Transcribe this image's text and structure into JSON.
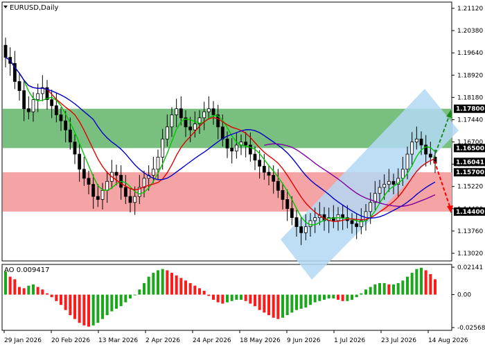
{
  "window": {
    "title": "EURUSD,Daily",
    "menu_icon": "triangle-down-icon"
  },
  "colors": {
    "support_zone": "#f4a4a4",
    "resistance_zone": "#78bf80",
    "channel": "#b3d8f3",
    "candle": "#000000",
    "fast_ma": "#00c800",
    "mid_ma": "#e00000",
    "slow_ma": "#0000c8",
    "purple_ma": "#8000a0",
    "ao_up": "#1aa81a",
    "ao_down": "#ff1a1a",
    "arrow_up": "#1e8a1e",
    "arrow_down": "#ff0000"
  },
  "price_axis": {
    "ticks": [
      "1.21120",
      "1.20380",
      "1.19640",
      "1.18920",
      "1.18180",
      "1.17440",
      "1.16700",
      "1.15960",
      "1.15220",
      "1.14480",
      "1.13760",
      "1.13020"
    ]
  },
  "levels": [
    {
      "label": "1.17800",
      "value": 1.178
    },
    {
      "label": "1.16500",
      "value": 1.165
    },
    {
      "label": "1.16041",
      "value": 1.16041
    },
    {
      "label": "1.15700",
      "value": 1.157
    },
    {
      "label": "1.14400",
      "value": 1.144
    }
  ],
  "ao": {
    "label": "AO 0.009417",
    "ticks": [
      "0.02141",
      "0.00",
      "-0.025685"
    ]
  },
  "time_axis": {
    "labels": [
      "29 Jan 2026",
      "20 Feb 2026",
      "13 Mar 2026",
      "2 Apr 2026",
      "24 Apr 2026",
      "18 May 2026",
      "9 Jun 2026",
      "1 Jul 2026",
      "23 Jul 2026",
      "14 Aug 2026"
    ]
  },
  "chart_data": {
    "type": "candlestick",
    "symbol": "EURUSD",
    "timeframe": "Daily",
    "ylim": [
      1.1302,
      1.2112
    ],
    "zones": [
      {
        "type": "resistance",
        "from": 1.165,
        "to": 1.178
      },
      {
        "type": "support",
        "from": 1.144,
        "to": 1.157
      }
    ],
    "closes": [
      1.195,
      1.193,
      1.187,
      1.184,
      1.178,
      1.177,
      1.181,
      1.183,
      1.185,
      1.181,
      1.179,
      1.176,
      1.174,
      1.171,
      1.167,
      1.163,
      1.158,
      1.155,
      1.153,
      1.149,
      1.148,
      1.151,
      1.154,
      1.157,
      1.156,
      1.152,
      1.149,
      1.147,
      1.149,
      1.152,
      1.155,
      1.156,
      1.158,
      1.162,
      1.168,
      1.172,
      1.176,
      1.178,
      1.175,
      1.172,
      1.171,
      1.173,
      1.175,
      1.177,
      1.178,
      1.176,
      1.172,
      1.168,
      1.165,
      1.164,
      1.166,
      1.167,
      1.166,
      1.163,
      1.161,
      1.159,
      1.157,
      1.156,
      1.154,
      1.151,
      1.148,
      1.145,
      1.142,
      1.139,
      1.137,
      1.139,
      1.141,
      1.142,
      1.143,
      1.141,
      1.142,
      1.141,
      1.143,
      1.142,
      1.141,
      1.14,
      1.139,
      1.141,
      1.144,
      1.147,
      1.15,
      1.152,
      1.153,
      1.154,
      1.153,
      1.155,
      1.158,
      1.163,
      1.167,
      1.168,
      1.166,
      1.163,
      1.162,
      1.16
    ],
    "ao_values": [
      0.018,
      0.014,
      0.012,
      0.006,
      0.005,
      0.007,
      0.008,
      0.006,
      0.004,
      0.001,
      -0.002,
      -0.005,
      -0.008,
      -0.012,
      -0.016,
      -0.019,
      -0.022,
      -0.024,
      -0.025,
      -0.024,
      -0.022,
      -0.019,
      -0.016,
      -0.013,
      -0.011,
      -0.009,
      -0.006,
      -0.003,
      0.0,
      0.004,
      0.009,
      0.014,
      0.017,
      0.019,
      0.02,
      0.019,
      0.017,
      0.015,
      0.013,
      0.011,
      0.009,
      0.007,
      0.005,
      0.003,
      -0.001,
      -0.004,
      -0.006,
      -0.007,
      -0.006,
      -0.005,
      -0.004,
      -0.004,
      -0.005,
      -0.007,
      -0.009,
      -0.012,
      -0.014,
      -0.016,
      -0.018,
      -0.019,
      -0.018,
      -0.016,
      -0.014,
      -0.012,
      -0.011,
      -0.01,
      -0.008,
      -0.006,
      -0.005,
      -0.004,
      -0.003,
      -0.003,
      -0.004,
      -0.005,
      -0.005,
      -0.004,
      -0.002,
      0.001,
      0.004,
      0.006,
      0.008,
      0.009,
      0.009,
      0.008,
      0.008,
      0.009,
      0.011,
      0.014,
      0.017,
      0.02,
      0.021,
      0.019,
      0.016,
      0.012
    ],
    "ma_periods": [
      5,
      10,
      20,
      30
    ]
  }
}
